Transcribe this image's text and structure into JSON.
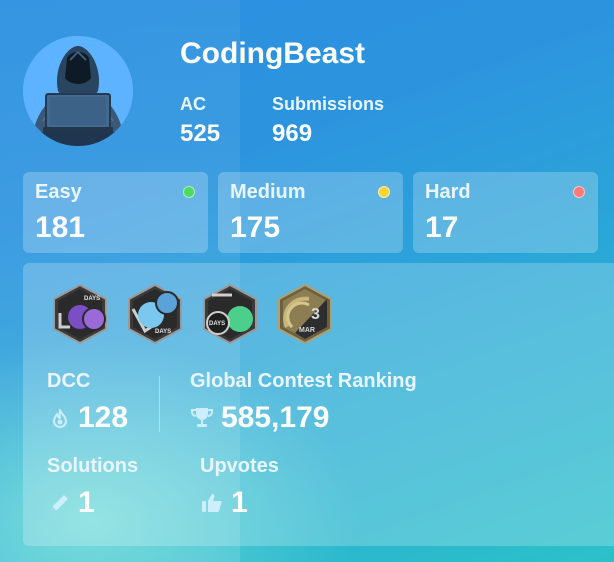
{
  "profile": {
    "username": "CodingBeast",
    "ac_label": "AC",
    "ac_value": "525",
    "submissions_label": "Submissions",
    "submissions_value": "969",
    "avatar": "hooded-hacker-with-laptop"
  },
  "difficulty": [
    {
      "label": "Easy",
      "value": "181",
      "color": "#4cd964"
    },
    {
      "label": "Medium",
      "value": "175",
      "color": "#ffd43b"
    },
    {
      "label": "Hard",
      "value": "17",
      "color": "#ff7b7b"
    }
  ],
  "badges": [
    {
      "icon": "days-badge-purple-icon",
      "text": "DAYS"
    },
    {
      "icon": "days-badge-blue-icon",
      "text": "DAYS"
    },
    {
      "icon": "days-badge-green-icon",
      "text": "DAYS"
    },
    {
      "icon": "march-badge-icon",
      "text": "3",
      "subtext": "MAR"
    }
  ],
  "stats": {
    "dcc_label": "DCC",
    "dcc_value": "128",
    "ranking_label": "Global Contest Ranking",
    "ranking_value": "585,179",
    "solutions_label": "Solutions",
    "solutions_value": "1",
    "upvotes_label": "Upvotes",
    "upvotes_value": "1"
  },
  "colors": {
    "background_top": "#2b8fe0",
    "background_bottom": "#2bc1c9",
    "card": "rgba(255,255,255,0.23)"
  }
}
